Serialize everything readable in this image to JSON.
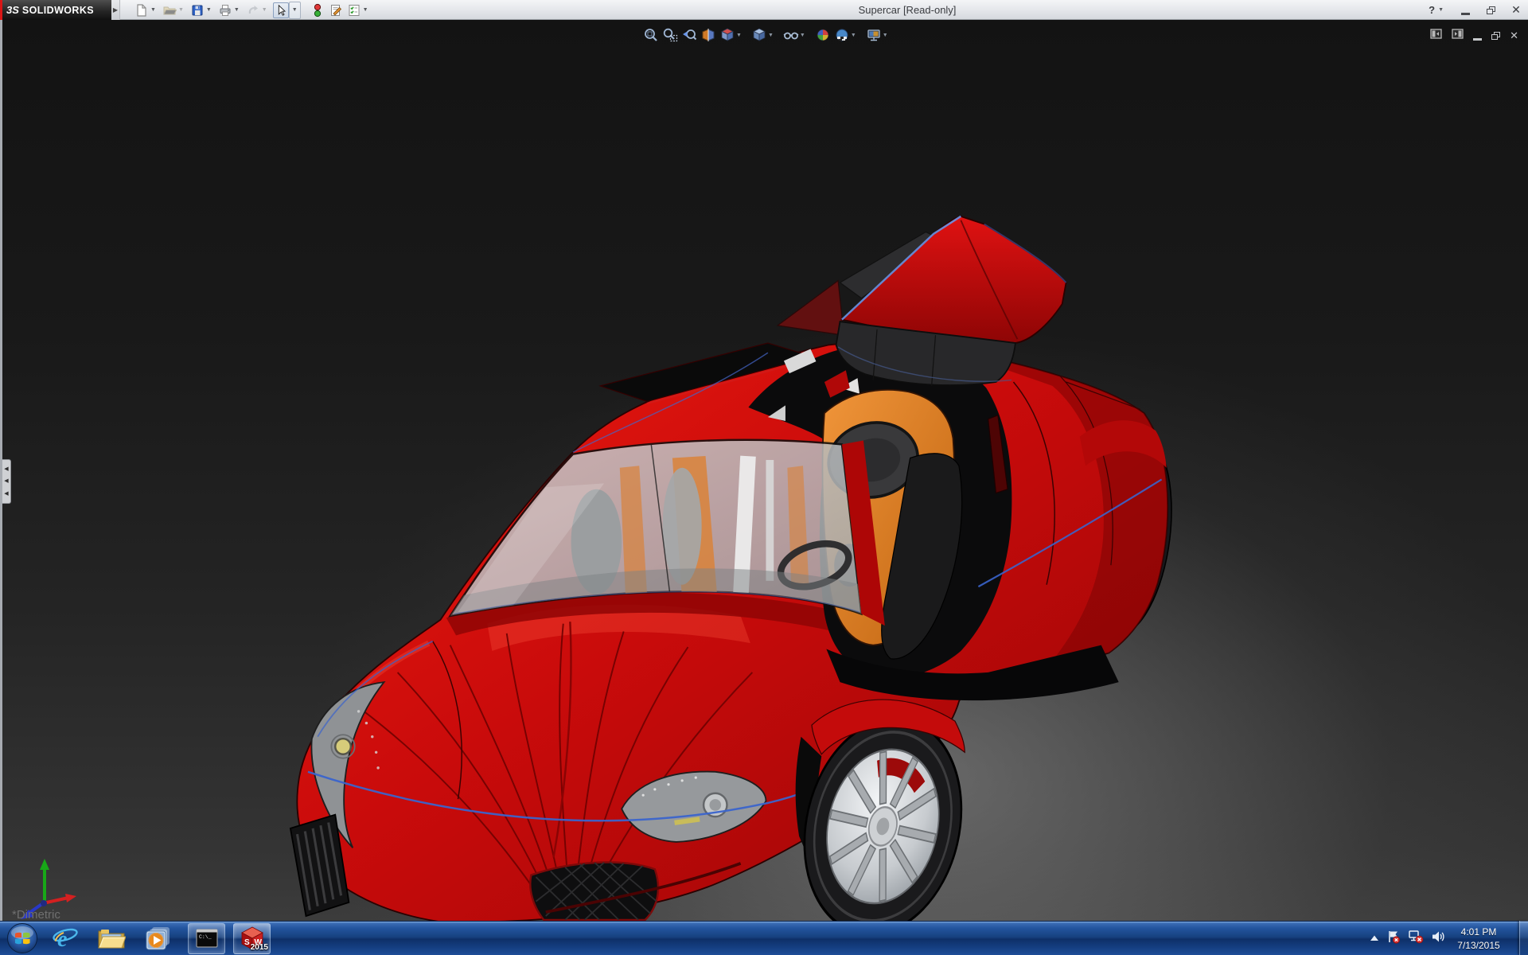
{
  "titlebar": {
    "brand_mark": "3S",
    "brand": "SOLIDWORKS",
    "title": "Supercar [Read-only]",
    "toolbar_icons": [
      {
        "name": "new-document-icon",
        "dropdown": true,
        "enabled": true
      },
      {
        "name": "open-folder-icon",
        "dropdown": true,
        "enabled": false
      },
      {
        "name": "save-icon",
        "dropdown": true,
        "enabled": true
      },
      {
        "name": "print-icon",
        "dropdown": true,
        "enabled": true
      },
      {
        "name": "undo-icon",
        "dropdown": true,
        "enabled": false
      },
      {
        "name": "select-cursor-icon",
        "dropdown": true,
        "enabled": true,
        "pressed": true
      },
      {
        "name": "rebuild-traffic-light-icon",
        "dropdown": false,
        "enabled": true
      },
      {
        "name": "file-properties-icon",
        "dropdown": false,
        "enabled": true
      },
      {
        "name": "options-checklist-icon",
        "dropdown": true,
        "enabled": true
      }
    ],
    "window_controls": [
      "help-icon",
      "minimize-icon",
      "restore-icon",
      "close-icon"
    ]
  },
  "headsup_toolbar": {
    "icons": [
      {
        "name": "zoom-to-fit-icon",
        "dropdown": false
      },
      {
        "name": "zoom-to-area-icon",
        "dropdown": false
      },
      {
        "name": "previous-view-icon",
        "dropdown": false
      },
      {
        "name": "section-view-icon",
        "dropdown": false
      },
      {
        "name": "view-orientation-icon",
        "dropdown": true
      },
      {
        "name": "display-style-icon",
        "dropdown": true
      },
      {
        "name": "hide-show-items-icon",
        "dropdown": true
      },
      {
        "name": "edit-appearance-icon",
        "dropdown": false
      },
      {
        "name": "apply-scene-icon",
        "dropdown": true
      },
      {
        "name": "view-settings-icon",
        "dropdown": true
      }
    ]
  },
  "viewport": {
    "orientation_label": "*Dimetric",
    "model_name": "Supercar",
    "document_controls": [
      "collapse-pane-left-icon",
      "collapse-pane-right-icon",
      "minimize-icon",
      "restore-icon",
      "close-icon"
    ],
    "pane_handle": "feature-manager-collapsed-handle",
    "triad_axes": [
      "x-red",
      "y-green",
      "z-blue"
    ],
    "colors": {
      "body_red": "#c90b0b",
      "body_shadow": "#7c0404",
      "seat_orange": "#e0801f",
      "glass_gray": "#b7babc",
      "interior_black": "#0b0b0c",
      "rim_silver": "#c7cbcf",
      "sketch_blue": "#3a64cc",
      "background_dark": "#151515",
      "background_glow": "#5e5e5e"
    }
  },
  "taskbar": {
    "items": [
      {
        "name": "start-button"
      },
      {
        "name": "internet-explorer-button"
      },
      {
        "name": "windows-explorer-button"
      },
      {
        "name": "media-player-button"
      },
      {
        "name": "command-prompt-button",
        "running": true,
        "icon_text": "C:\\_"
      },
      {
        "name": "solidworks-2015-button",
        "running": true,
        "active": true,
        "badge": "2015"
      }
    ],
    "tray": {
      "icons": [
        "show-hidden-icons-icon",
        "action-center-flag-icon",
        "network-disconnected-icon",
        "volume-icon"
      ],
      "time": "4:01 PM",
      "date": "7/13/2015"
    },
    "show_desktop": "show-desktop-button"
  }
}
